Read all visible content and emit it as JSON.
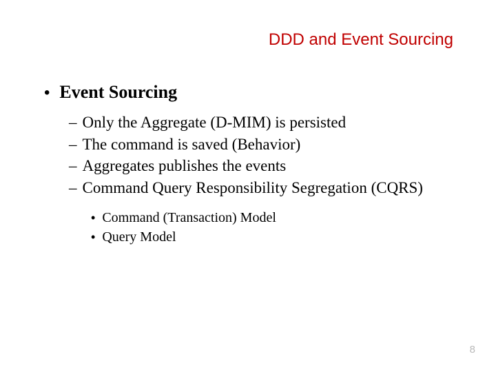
{
  "title": "DDD and Event Sourcing",
  "heading": "Event Sourcing",
  "sub": {
    "a": "Only the Aggregate (D-MIM) is persisted",
    "b": "The command is saved (Behavior)",
    "c": "Aggregates publishes the events",
    "d": "Command Query Responsibility Segregation (CQRS)"
  },
  "subsub": {
    "a": "Command (Transaction) Model",
    "b": "Query Model"
  },
  "bullets": {
    "dot": "•",
    "dash": "–"
  },
  "page": "8"
}
